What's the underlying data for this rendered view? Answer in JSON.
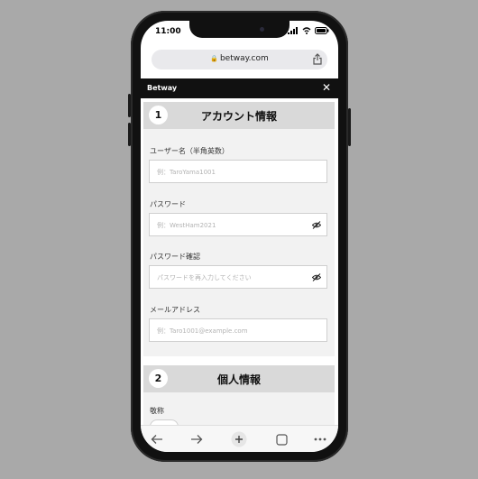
{
  "status": {
    "time": "11:00"
  },
  "browser": {
    "url": "betway.com"
  },
  "brand": {
    "title": "Betway",
    "close": "✕"
  },
  "section1": {
    "number": "1",
    "title": "アカウント情報",
    "fields": [
      {
        "label": "ユーザー名（半角英数）",
        "placeholder": "例：TaroYama1001"
      },
      {
        "label": "パスワード",
        "placeholder": "例：WestHam2021"
      },
      {
        "label": "パスワード確認",
        "placeholder": "パスワードを再入力してください"
      },
      {
        "label": "メールアドレス",
        "placeholder": "例：Taro1001@example.com"
      }
    ]
  },
  "section2": {
    "number": "2",
    "title": "個人情報",
    "fields": [
      {
        "label": "敬称"
      }
    ]
  },
  "icons": {
    "back": "arrow-left-icon",
    "forward": "arrow-right-icon",
    "new_tab": "plus-icon",
    "tabs": "tabs-icon",
    "menu": "more-icon",
    "eye": "eye-off-icon"
  }
}
